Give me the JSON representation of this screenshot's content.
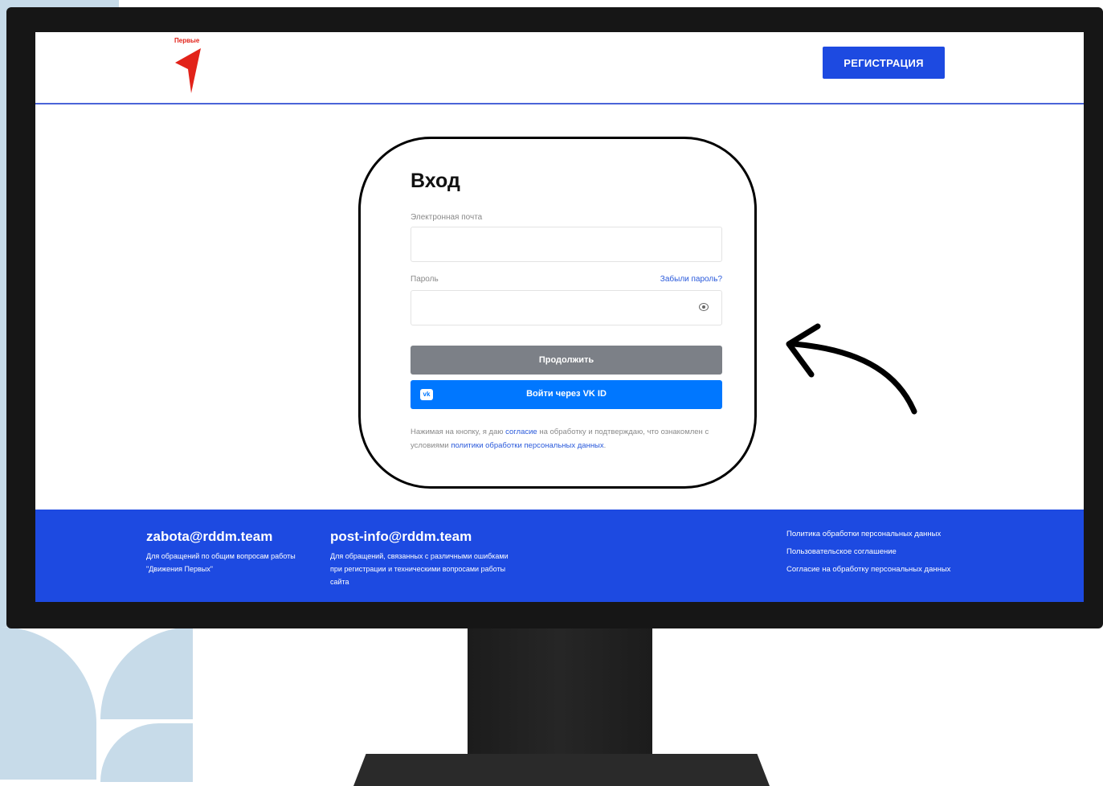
{
  "logo": {
    "text": "Первые",
    "brand_color": "#e2231a"
  },
  "header": {
    "register_label": "РЕГИСТРАЦИЯ",
    "accent": "#1d4ae1"
  },
  "login": {
    "title": "Вход",
    "email_label": "Электронная почта",
    "email_value": "",
    "password_label": "Пароль",
    "password_value": "",
    "forgot_label": "Забыли пароль?",
    "continue_label": "Продолжить",
    "vk_label": "Войти через VK ID",
    "vk_icon": "vk-icon",
    "note_part1": "Нажимая на кнопку, я даю ",
    "note_link1": "согласие",
    "note_part2": " на обработку и подтверждаю, что ознакомлен с условиями ",
    "note_link2": "политики обработки персональных данных"
  },
  "footer": {
    "contact1": {
      "email": "zabota@rddm.team",
      "desc": "Для обращений по общим вопросам работы \"Движения Первых\""
    },
    "contact2": {
      "email": "post-info@rddm.team",
      "desc": "Для обращений, связанных с различными ошибками при регистрации и техническими вопросами работы сайта"
    },
    "links": [
      "Политика обработки персональных данных",
      "Пользовательское соглашение",
      "Согласие на обработку персональных данных"
    ]
  },
  "colors": {
    "primary": "#1d4ae1",
    "vk": "#0077ff",
    "disabled_button": "#7c8087"
  }
}
